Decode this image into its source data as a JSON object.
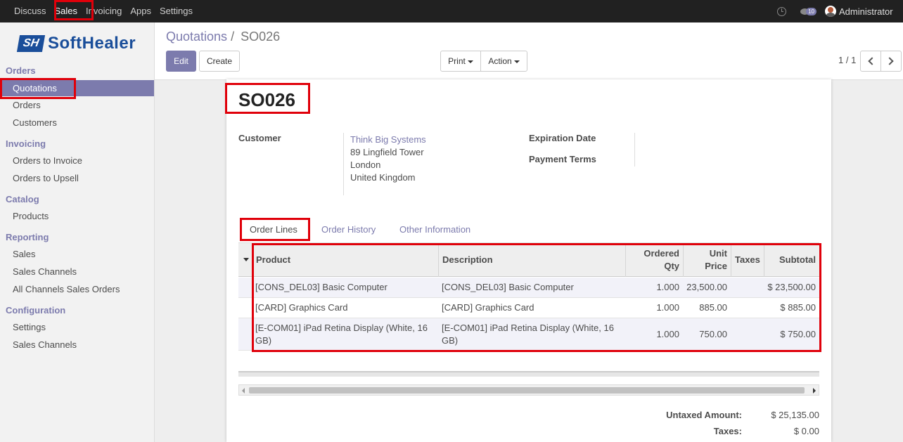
{
  "topbar": {
    "menu": [
      "Discuss",
      "Sales",
      "Invoicing",
      "Apps",
      "Settings"
    ],
    "active": "Sales",
    "messages_count": "10",
    "user_name": "Administrator"
  },
  "sidebar": {
    "brand": "SoftHealer",
    "logo_mark": "SH",
    "groups": {
      "orders": {
        "title": "Orders",
        "items": [
          "Quotations",
          "Orders",
          "Customers"
        ]
      },
      "invoicing": {
        "title": "Invoicing",
        "items": [
          "Orders to Invoice",
          "Orders to Upsell"
        ]
      },
      "catalog": {
        "title": "Catalog",
        "items": [
          "Products"
        ]
      },
      "reporting": {
        "title": "Reporting",
        "items": [
          "Sales",
          "Sales Channels",
          "All Channels Sales Orders"
        ]
      },
      "configuration": {
        "title": "Configuration",
        "items": [
          "Settings",
          "Sales Channels"
        ]
      }
    },
    "active_item": "Quotations"
  },
  "breadcrumb": {
    "parent": "Quotations",
    "separator": "/",
    "current": "SO026"
  },
  "buttons": {
    "edit": "Edit",
    "create": "Create",
    "print": "Print",
    "action": "Action"
  },
  "pager": {
    "value": "1 / 1"
  },
  "record": {
    "name": "SO026",
    "customer_label": "Customer",
    "customer_name": "Think Big Systems",
    "address": [
      "89 Lingfield Tower",
      "London",
      "United Kingdom"
    ],
    "expiration_label": "Expiration Date",
    "payment_terms_label": "Payment Terms"
  },
  "tabs": [
    "Order Lines",
    "Order History",
    "Other Information"
  ],
  "table": {
    "headers": {
      "product": "Product",
      "description": "Description",
      "qty_1": "Ordered",
      "qty_2": "Qty",
      "price_1": "Unit",
      "price_2": "Price",
      "taxes": "Taxes",
      "subtotal": "Subtotal"
    },
    "rows": [
      {
        "product": "[CONS_DEL03] Basic Computer",
        "description": "[CONS_DEL03] Basic Computer",
        "qty": "1.000",
        "price": "23,500.00",
        "taxes": "",
        "subtotal": "$ 23,500.00"
      },
      {
        "product": "[CARD] Graphics Card",
        "description": "[CARD] Graphics Card",
        "qty": "1.000",
        "price": "885.00",
        "taxes": "",
        "subtotal": "$ 885.00"
      },
      {
        "product": "[E-COM01] iPad Retina Display (White, 16 GB)",
        "description": "[E-COM01] iPad Retina Display (White, 16 GB)",
        "qty": "1.000",
        "price": "750.00",
        "taxes": "",
        "subtotal": "$ 750.00"
      }
    ]
  },
  "totals": {
    "untaxed_label": "Untaxed Amount:",
    "untaxed_value": "$ 25,135.00",
    "taxes_label": "Taxes:",
    "taxes_value": "$ 0.00"
  },
  "colors": {
    "accent": "#7c7bad",
    "highlight": "#e0000a",
    "topbar": "#212121"
  }
}
